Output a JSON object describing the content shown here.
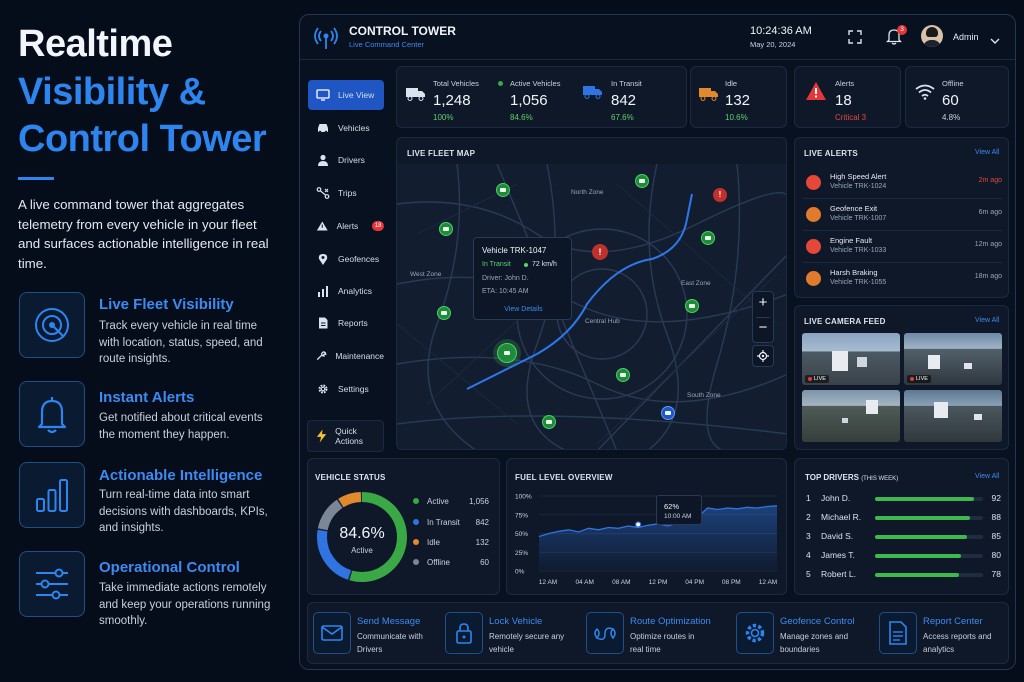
{
  "hero": {
    "title_line1": "Realtime",
    "title_line2": "Visibility &",
    "title_line3": "Control Tower",
    "description": "A live command tower that aggregates telemetry from every vehicle in your fleet and surfaces actionable intelligence in real time.",
    "features": [
      {
        "icon": "radar-icon",
        "title": "Live Fleet Visibility",
        "desc": "Track every vehicle in real time with location, status, speed, and route insights."
      },
      {
        "icon": "bell-icon",
        "title": "Instant Alerts",
        "desc": "Get notified about critical events the moment they happen."
      },
      {
        "icon": "bar-chart-icon",
        "title": "Actionable Intelligence",
        "desc": "Turn real-time data into smart decisions with dashboards, KPIs, and insights."
      },
      {
        "icon": "sliders-icon",
        "title": "Operational Control",
        "desc": "Take immediate actions remotely and keep your operations running smoothly."
      }
    ]
  },
  "header": {
    "title": "CONTROL TOWER",
    "subtitle": "Live Command Center",
    "time": "10:24:36 AM",
    "date": "May 20, 2024",
    "notification_count": "3",
    "user": "Admin"
  },
  "sidebar": {
    "items": [
      {
        "label": "Live View",
        "icon": "monitor-icon",
        "active": true
      },
      {
        "label": "Vehicles",
        "icon": "car-icon"
      },
      {
        "label": "Drivers",
        "icon": "user-icon"
      },
      {
        "label": "Trips",
        "icon": "route-icon"
      },
      {
        "label": "Alerts",
        "icon": "alert-icon",
        "badge": "18"
      },
      {
        "label": "Geofences",
        "icon": "pin-icon"
      },
      {
        "label": "Analytics",
        "icon": "analytics-icon"
      },
      {
        "label": "Reports",
        "icon": "report-icon"
      },
      {
        "label": "Maintenance",
        "icon": "wrench-icon"
      },
      {
        "label": "Settings",
        "icon": "gear-icon"
      }
    ],
    "quick_actions": "Quick Actions"
  },
  "kpis": [
    {
      "label": "Total Vehicles",
      "value": "1,248",
      "pct": "100%"
    },
    {
      "label": "Active Vehicles",
      "value": "1,056",
      "pct": "84.6%"
    },
    {
      "label": "In Transit",
      "value": "842",
      "pct": "67.6%"
    },
    {
      "label": "Idle",
      "value": "132",
      "pct": "10.6%"
    },
    {
      "label": "Alerts",
      "value": "18",
      "pct": "Critical 3"
    },
    {
      "label": "Offline",
      "value": "60",
      "pct": "4.8%"
    }
  ],
  "map": {
    "title": "LIVE FLEET MAP",
    "zones": [
      "North Zone",
      "West Zone",
      "East Zone",
      "Central Hub",
      "South Zone"
    ],
    "popup": {
      "vehicle": "Vehicle TRK-1047",
      "status": "In Transit",
      "speed": "72 km/h",
      "driver": "Driver: John D.",
      "eta": "ETA: 10:45 AM",
      "link": "View Details"
    },
    "zoom_in": "+",
    "zoom_out": "−"
  },
  "live_alerts": {
    "title": "LIVE ALERTS",
    "view_all": "View All",
    "items": [
      {
        "title": "High Speed Alert",
        "vehicle": "Vehicle TRK-1024",
        "time": "2m ago",
        "color": "#e5483b"
      },
      {
        "title": "Geofence Exit",
        "vehicle": "Vehicle TRK-1007",
        "time": "6m ago",
        "color": "#e07a2c"
      },
      {
        "title": "Engine Fault",
        "vehicle": "Vehicle TRK-1033",
        "time": "12m ago",
        "color": "#e5483b"
      },
      {
        "title": "Harsh Braking",
        "vehicle": "Vehicle TRK-1055",
        "time": "18m ago",
        "color": "#e07a2c"
      }
    ]
  },
  "camera": {
    "title": "LIVE CAMERA FEED",
    "view_all": "View All",
    "live": "LIVE"
  },
  "vehicle_status": {
    "title": "VEHICLE STATUS",
    "center_value": "84.6%",
    "center_label": "Active",
    "legend": [
      {
        "label": "Active",
        "value": "1,056",
        "color": "#3aa845"
      },
      {
        "label": "In Transit",
        "value": "842",
        "color": "#2f74e0"
      },
      {
        "label": "Idle",
        "value": "132",
        "color": "#e08a2c"
      },
      {
        "label": "Offline",
        "value": "60",
        "color": "#7b8696"
      }
    ]
  },
  "fuel": {
    "title": "FUEL LEVEL OVERVIEW",
    "tooltip_value": "62%",
    "tooltip_time": "10:00 AM"
  },
  "top_drivers": {
    "title": "TOP DRIVERS",
    "title_suffix": "(THIS WEEK)",
    "view_all": "View All",
    "rows": [
      {
        "rank": "1",
        "name": "John D.",
        "score": 92
      },
      {
        "rank": "2",
        "name": "Michael R.",
        "score": 88
      },
      {
        "rank": "3",
        "name": "David S.",
        "score": 85
      },
      {
        "rank": "4",
        "name": "James T.",
        "score": 80
      },
      {
        "rank": "5",
        "name": "Robert L.",
        "score": 78
      }
    ]
  },
  "quick_actions": [
    {
      "icon": "mail-icon",
      "title": "Send Message",
      "desc": "Communicate with Drivers"
    },
    {
      "icon": "lock-icon",
      "title": "Lock Vehicle",
      "desc": "Remotely secure any vehicle"
    },
    {
      "icon": "route-optimization-icon",
      "title": "Route Optimization",
      "desc": "Optimize routes in real time"
    },
    {
      "icon": "gear-icon",
      "title": "Geofence Control",
      "desc": "Manage zones and boundaries"
    },
    {
      "icon": "document-icon",
      "title": "Report Center",
      "desc": "Access reports and analytics"
    }
  ],
  "chart_data": {
    "type": "area",
    "title": "FUEL LEVEL OVERVIEW",
    "x_ticks": [
      "12 AM",
      "04 AM",
      "08 AM",
      "12 PM",
      "04 PM",
      "08 PM",
      "12 AM"
    ],
    "y_ticks": [
      "0%",
      "25%",
      "50%",
      "75%",
      "100%"
    ],
    "ylim": [
      0,
      100
    ],
    "x": [
      0,
      1,
      2,
      3,
      4,
      5,
      6,
      7,
      8,
      9,
      10,
      11,
      12,
      13,
      14,
      15,
      16,
      17,
      18,
      19,
      20,
      21,
      22,
      23,
      24
    ],
    "series": [
      {
        "values": [
          46,
          50,
          53,
          55,
          52,
          57,
          55,
          58,
          57,
          60,
          58,
          61,
          63,
          60,
          64,
          62,
          72,
          84,
          82,
          84,
          83,
          85,
          84,
          86,
          87
        ]
      }
    ],
    "highlight": {
      "x": 10,
      "y": 62
    }
  }
}
